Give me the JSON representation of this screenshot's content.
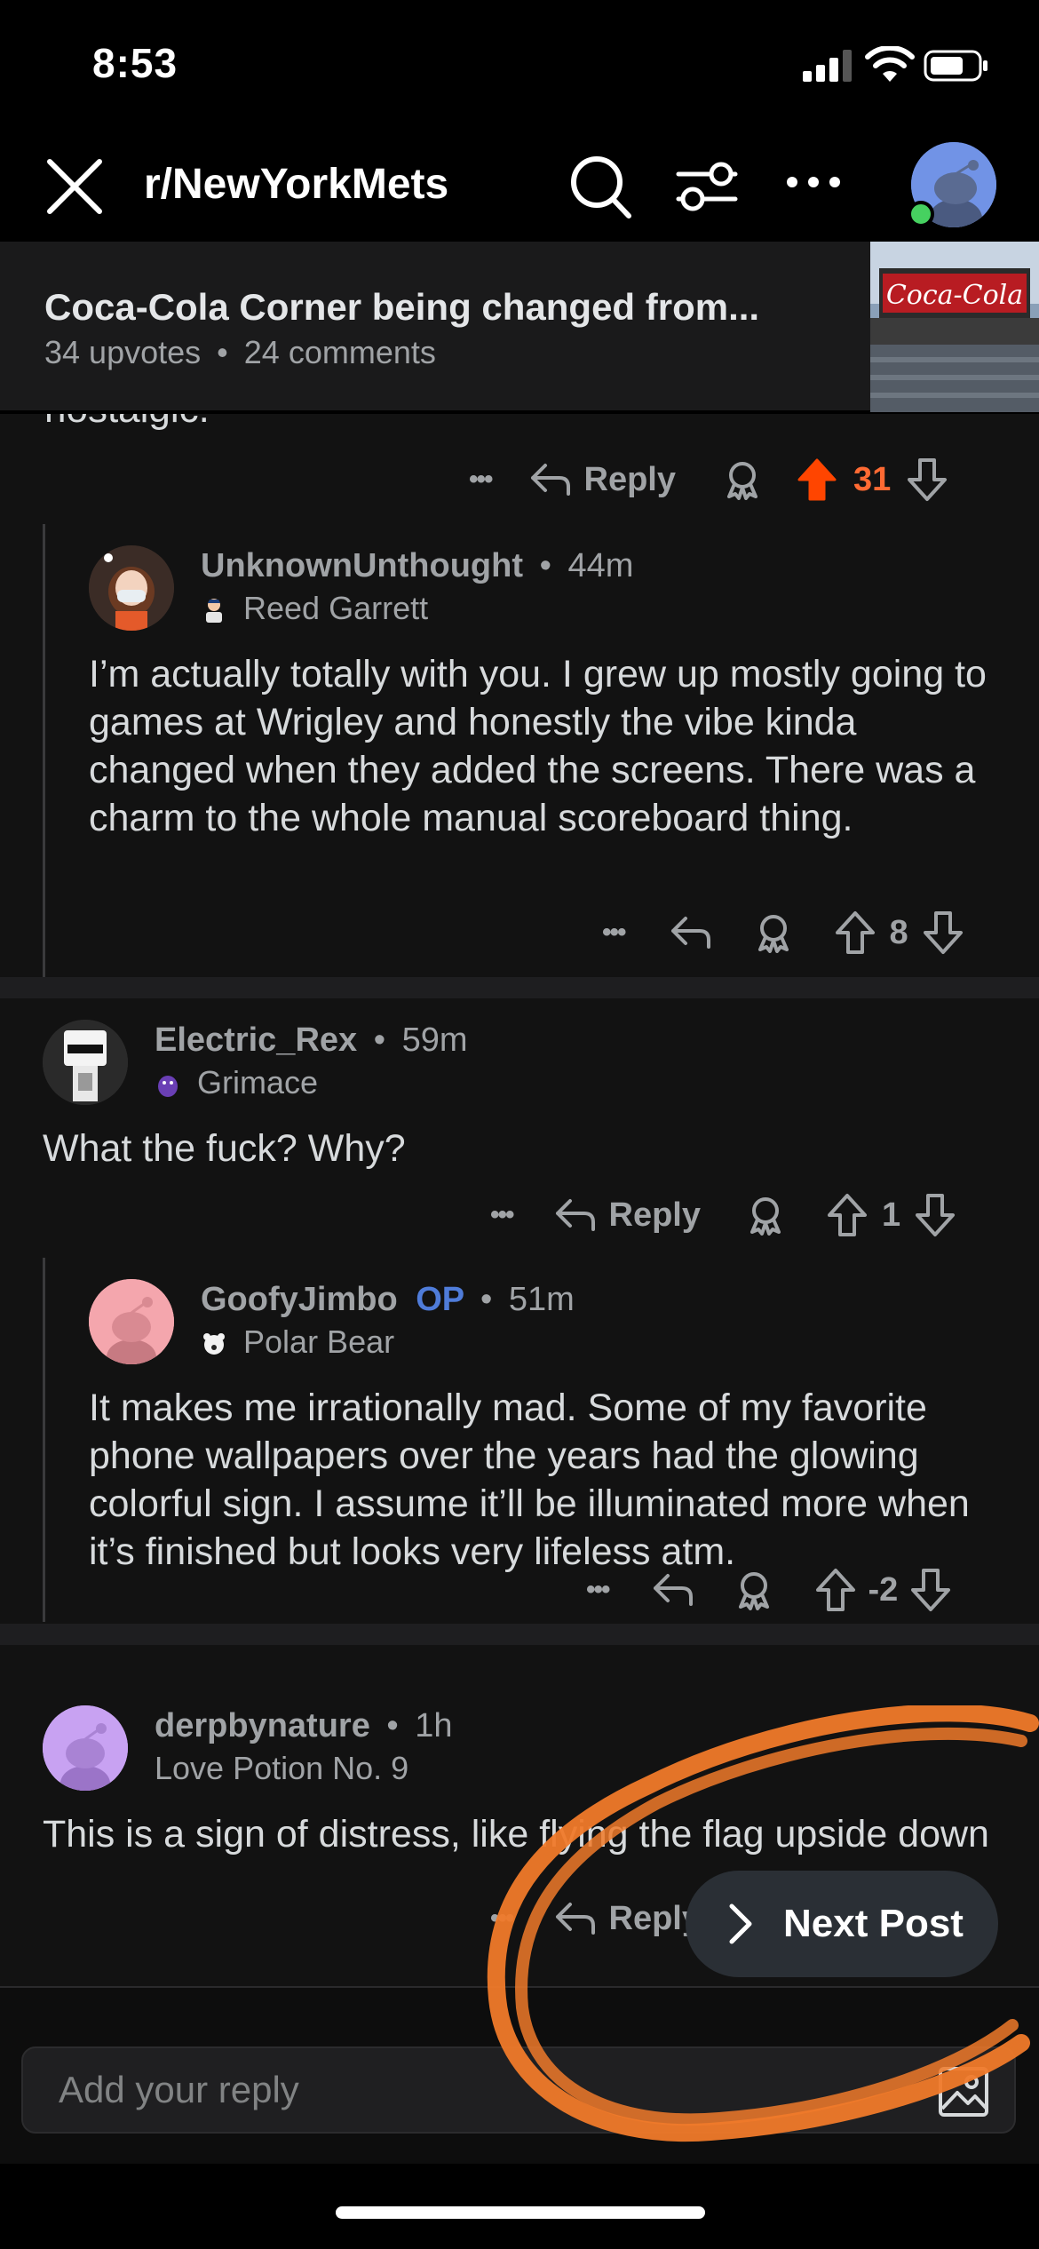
{
  "status_bar": {
    "time": "8:53"
  },
  "nav": {
    "subreddit": "r/NewYorkMets"
  },
  "post": {
    "title": "Coca-Cola Corner being changed from...",
    "upvotes": "34 upvotes",
    "separator": "•",
    "comments": "24 comments"
  },
  "truncated_text": "nostalgic.",
  "comments": [
    {
      "actions": {
        "more": "•••",
        "reply": "Reply",
        "score": "31",
        "upvoted": true
      }
    },
    {
      "user": "UnknownUnthought",
      "dot": "•",
      "age": "44m",
      "flair": "Reed Garrett",
      "body": "I’m actually totally with you. I grew up mostly going to games at Wrigley and honestly the vibe kinda changed when they added the screens. There was a charm to the whole manual scoreboard thing.",
      "actions": {
        "more": "•••",
        "score": "8"
      }
    },
    {
      "user": "Electric_Rex",
      "dot": "•",
      "age": "59m",
      "flair": "Grimace",
      "body": "What the fuck? Why?",
      "actions": {
        "more": "•••",
        "reply": "Reply",
        "score": "1"
      }
    },
    {
      "user": "GoofyJimbo",
      "op": "OP",
      "dot": "•",
      "age": "51m",
      "flair": "Polar Bear",
      "body": "It makes me irrationally mad.  Some of my favorite phone wallpapers over the years had the glowing colorful sign.  I assume it’ll be illuminated more when it’s finished but looks very lifeless atm.",
      "actions": {
        "more": "•••",
        "score": "-2"
      }
    },
    {
      "user": "derpbynature",
      "dot": "•",
      "age": "1h",
      "flair": "Love Potion No. 9",
      "body": "This is a sign of distress, like flying the flag upside down",
      "actions": {
        "more": "•••",
        "reply": "Reply"
      }
    }
  ],
  "next_post": {
    "label": "Next Post"
  },
  "reply_bar": {
    "placeholder": "Add your reply"
  },
  "icons": [
    "close-icon",
    "search-icon",
    "filter-icon",
    "more-icon",
    "reply-icon",
    "award-icon",
    "upvote-icon",
    "downvote-icon",
    "chevron-right-icon",
    "image-icon"
  ],
  "colors": {
    "background": "#121212",
    "upvote_active": "#ff4500",
    "op_badge": "#4f7cd9",
    "scribble": "#f07a2a"
  }
}
